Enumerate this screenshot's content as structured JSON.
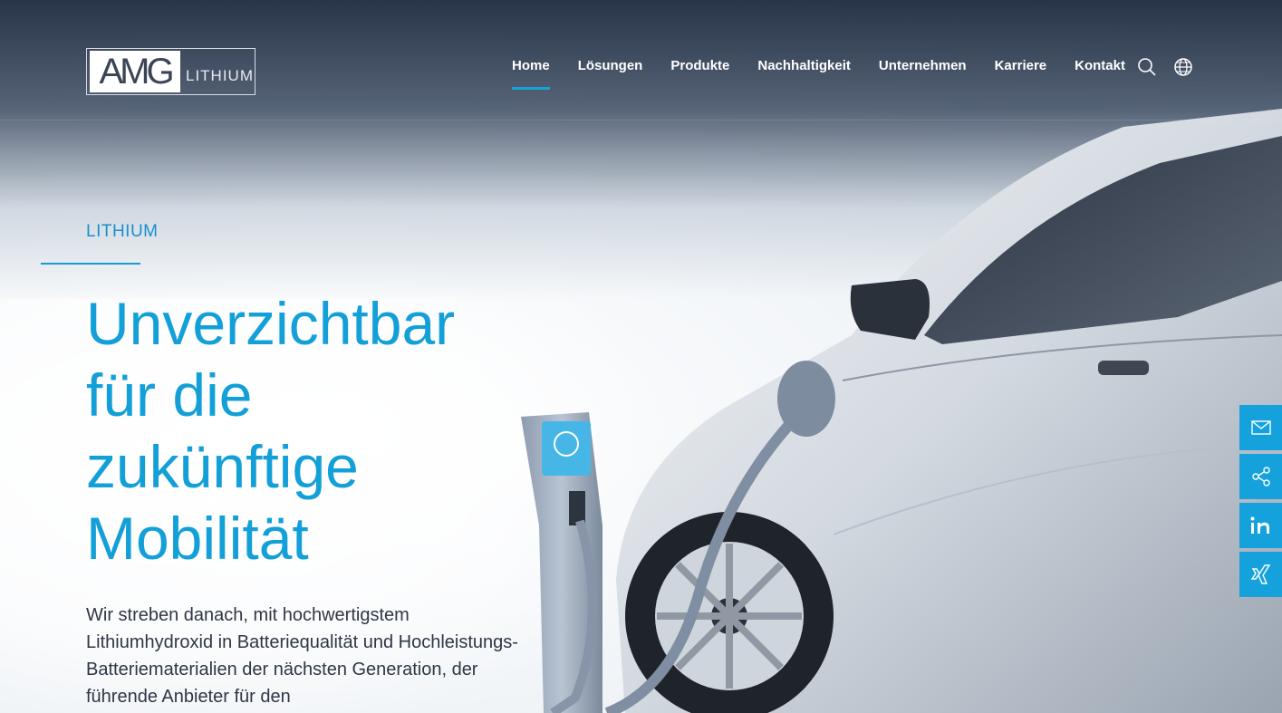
{
  "logo": {
    "mark": "AMG",
    "text": "LITHIUM"
  },
  "nav": {
    "items": [
      {
        "label": "Home",
        "active": true
      },
      {
        "label": "Lösungen"
      },
      {
        "label": "Produkte"
      },
      {
        "label": "Nachhaltigkeit"
      },
      {
        "label": "Unternehmen"
      },
      {
        "label": "Karriere"
      },
      {
        "label": "Kontakt"
      }
    ],
    "icons": [
      "search-icon",
      "globe-icon"
    ]
  },
  "hero": {
    "eyebrow": "LITHIUM",
    "headline_lines": [
      "Unverzichtbar",
      "für die",
      "zukünftige",
      "Mobilität"
    ],
    "body": "Wir streben danach, mit hochwertigstem Lithiumhydroxid in Batteriequalität und Hochleistungs-Batteriematerialien der nächsten Generation, der führende Anbieter für den"
  },
  "side_rail": [
    "mail-icon",
    "share-icon",
    "linkedin-icon",
    "xing-icon"
  ],
  "colors": {
    "accent": "#15a2dc",
    "header_bg": "#1e2a3e",
    "body_text": "#2f3745"
  }
}
